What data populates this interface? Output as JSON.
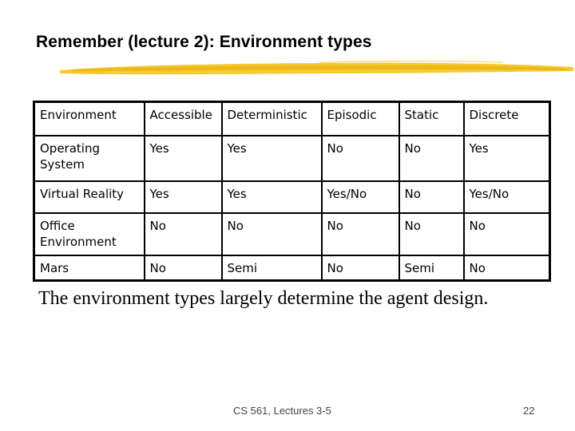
{
  "slide": {
    "title": "Remember (lecture 2): Environment types",
    "accent_color": "#f2c318",
    "caption": "The environment types largely determine the agent design.",
    "footer": "CS 561,  Lectures 3-5",
    "page_number": "22"
  },
  "table": {
    "headers": [
      "Environment",
      "Accessible",
      "Deterministic",
      "Episodic",
      "Static",
      "Discrete"
    ],
    "rows": [
      [
        "Operating System",
        "Yes",
        "Yes",
        "No",
        "No",
        "Yes"
      ],
      [
        "Virtual Reality",
        "Yes",
        "Yes",
        "Yes/No",
        "No",
        "Yes/No"
      ],
      [
        "Office Environment",
        "No",
        "No",
        "No",
        "No",
        "No"
      ],
      [
        "Mars",
        "No",
        "Semi",
        "No",
        "Semi",
        "No"
      ]
    ]
  }
}
